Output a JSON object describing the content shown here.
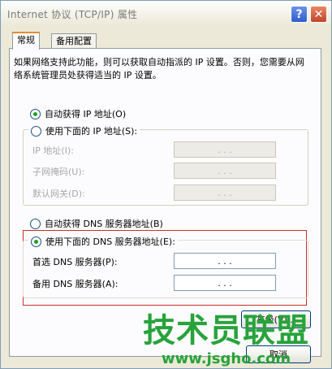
{
  "window": {
    "title": "Internet 协议 (TCP/IP) 属性",
    "help_label": "?",
    "close_label": "✕"
  },
  "tabs": [
    {
      "label": "常规",
      "active": true
    },
    {
      "label": "备用配置",
      "active": false
    }
  ],
  "description": "如果网络支持此功能，则可以获取自动指派的 IP 设置。否则，您需要从网络系统管理员处获得适当的 IP 设置。",
  "ip": {
    "auto_label": "自动获得 IP 地址(O)",
    "auto_selected": true,
    "manual_label": "使用下面的 IP 地址(S):",
    "manual_selected": false,
    "fields": [
      {
        "label": "IP 地址(I):",
        "value": ". . ."
      },
      {
        "label": "子网掩码(U):",
        "value": ". . ."
      },
      {
        "label": "默认网关(D):",
        "value": ". . ."
      }
    ]
  },
  "dns": {
    "auto_label": "自动获得 DNS 服务器地址(B)",
    "auto_selected": false,
    "manual_label": "使用下面的 DNS 服务器地址(E):",
    "manual_selected": true,
    "fields": [
      {
        "label": "首选 DNS 服务器(P):",
        "value": ". . ."
      },
      {
        "label": "备用 DNS 服务器(A):",
        "value": ". . ."
      }
    ]
  },
  "buttons": {
    "advanced": "高级(V)...",
    "cancel": "取消"
  },
  "colors": {
    "highlight_border": "#c8312c",
    "radio_dot": "#21a121",
    "watermark": "#27a33a"
  },
  "watermark": {
    "text": "技术员联盟",
    "url": "www.jsgho.com"
  }
}
